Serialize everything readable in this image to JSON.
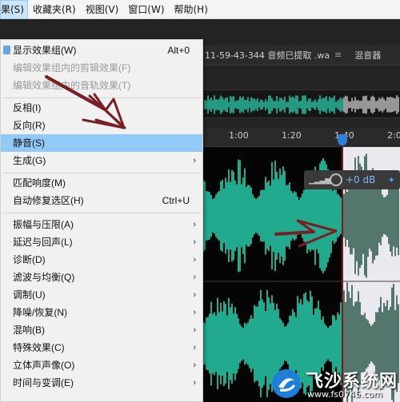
{
  "menubar": {
    "items": [
      {
        "label": "果(S)",
        "active": true
      },
      {
        "label": "收藏夹(R)",
        "active": false
      },
      {
        "label": "视图(V)",
        "active": false
      },
      {
        "label": "窗口(W)",
        "active": false
      },
      {
        "label": "帮助(H)",
        "active": false
      }
    ]
  },
  "editor": {
    "tab_file": "11-59-43-344 音频已提取 .wav",
    "tab_sep_icon": "hamburger-icon",
    "tab_mixer": "混音器",
    "ruler_ticks": [
      "1:00",
      "1:20",
      "1:40",
      "2:0"
    ],
    "hud_gain": "+0 dB",
    "selection_color": "#e9e9ef",
    "wave_color": "#2ad3b0",
    "wave_color_selected": "#2e5a4c"
  },
  "effects_menu": {
    "items": [
      {
        "label": "显示效果组(W)",
        "shortcut": "Alt+0",
        "checked": true,
        "disabled": false,
        "submenu": false
      },
      {
        "label": "编辑效果组内的剪辑效果(F)",
        "shortcut": "",
        "disabled": true,
        "submenu": false
      },
      {
        "label": "编辑效果组内的音轨效果(T)",
        "shortcut": "",
        "disabled": true,
        "submenu": false
      },
      {
        "label": "反相(I)",
        "shortcut": "",
        "disabled": false,
        "submenu": false
      },
      {
        "label": "反向(R)",
        "shortcut": "",
        "disabled": false,
        "submenu": false
      },
      {
        "label": "静音(S)",
        "shortcut": "",
        "disabled": false,
        "submenu": false,
        "highlighted": true
      },
      {
        "label": "生成(G)",
        "shortcut": "",
        "disabled": false,
        "submenu": true
      },
      {
        "label": "匹配响度(M)",
        "shortcut": "",
        "disabled": false,
        "submenu": false
      },
      {
        "label": "自动修复选区(H)",
        "shortcut": "Ctrl+U",
        "disabled": false,
        "submenu": false
      },
      {
        "label": "振幅与压限(A)",
        "shortcut": "",
        "disabled": false,
        "submenu": true
      },
      {
        "label": "延迟与回声(L)",
        "shortcut": "",
        "disabled": false,
        "submenu": true
      },
      {
        "label": "诊断(D)",
        "shortcut": "",
        "disabled": false,
        "submenu": true
      },
      {
        "label": "滤波与均衡(Q)",
        "shortcut": "",
        "disabled": false,
        "submenu": true
      },
      {
        "label": "调制(U)",
        "shortcut": "",
        "disabled": false,
        "submenu": true
      },
      {
        "label": "降噪/恢复(N)",
        "shortcut": "",
        "disabled": false,
        "submenu": true
      },
      {
        "label": "混响(B)",
        "shortcut": "",
        "disabled": false,
        "submenu": true
      },
      {
        "label": "特殊效果(C)",
        "shortcut": "",
        "disabled": false,
        "submenu": true
      },
      {
        "label": "立体声声像(O)",
        "shortcut": "",
        "disabled": false,
        "submenu": true
      },
      {
        "label": "时间与变调(E)",
        "shortcut": "",
        "disabled": false,
        "submenu": true
      }
    ],
    "highlight_color": "#91c9f7",
    "arrow_glyph": "›"
  },
  "annotation": {
    "arrow_color": "#7a1e26"
  },
  "watermark": {
    "title": "飞沙系统网",
    "url": "www.fs0745.com"
  }
}
